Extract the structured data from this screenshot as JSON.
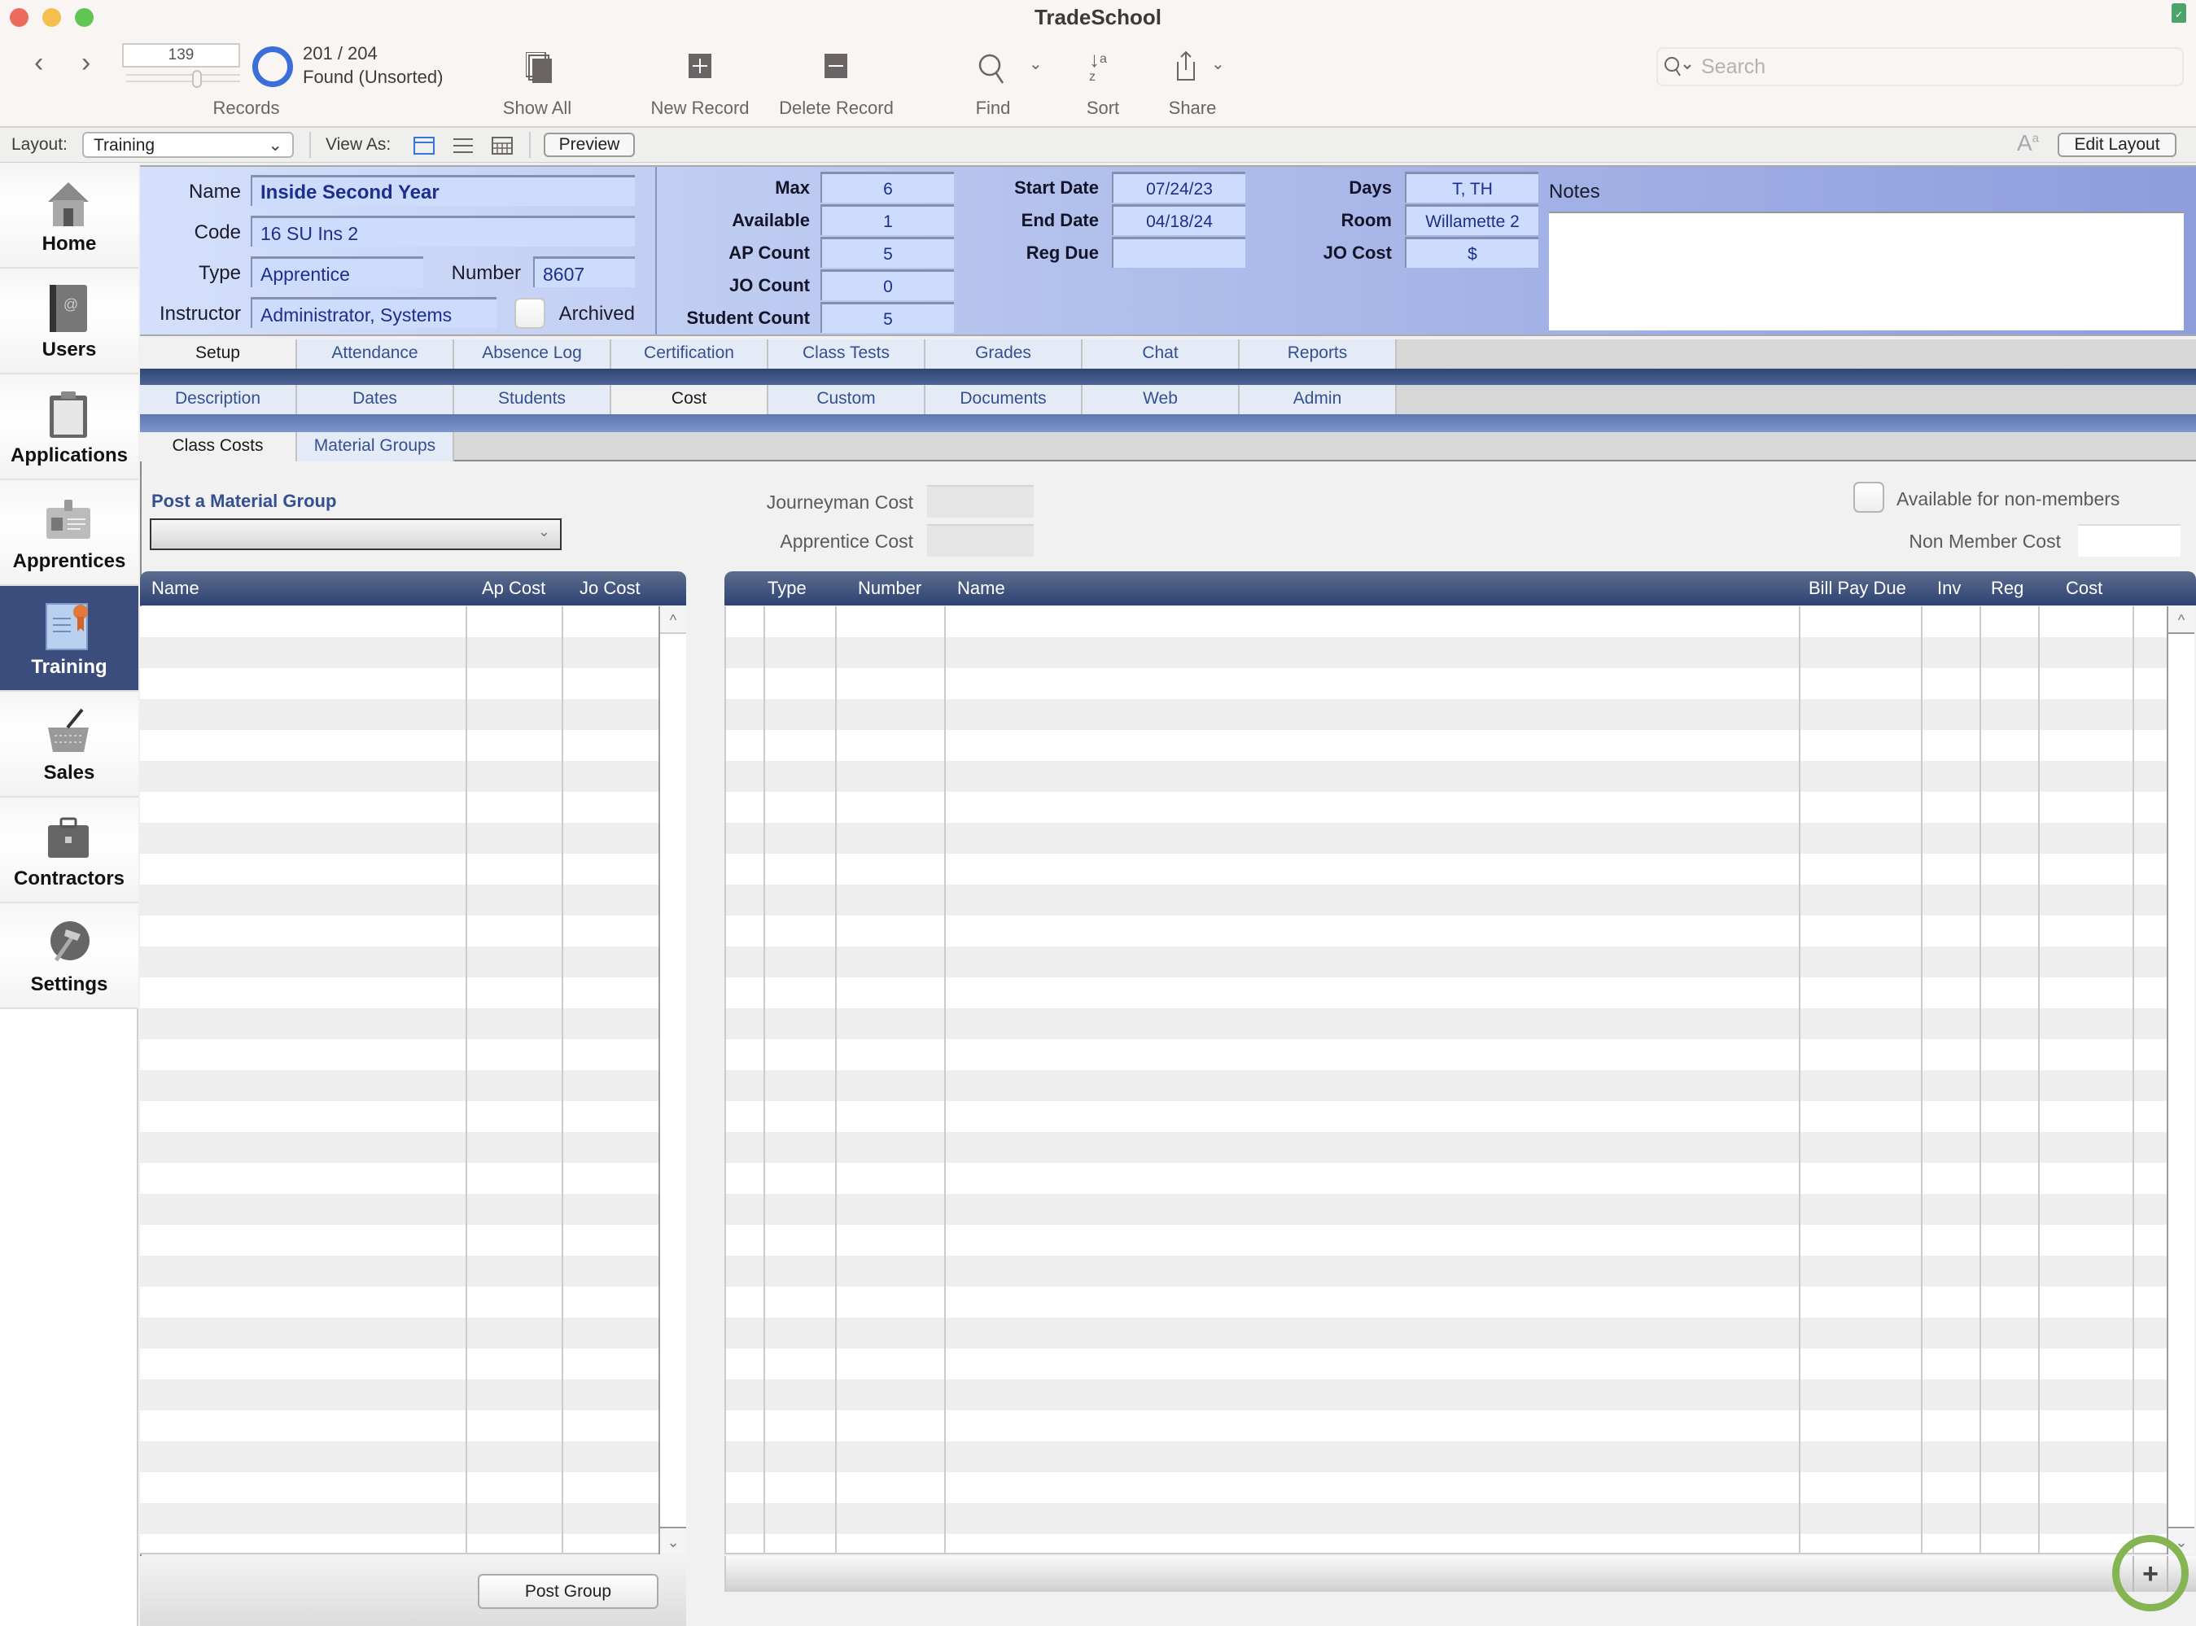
{
  "window": {
    "title": "TradeSchool"
  },
  "toolbar": {
    "record_number": "139",
    "found_count": "201 / 204",
    "found_status": "Found (Unsorted)",
    "records_label": "Records",
    "show_all": "Show All",
    "new_record": "New Record",
    "delete_record": "Delete Record",
    "find": "Find",
    "sort": "Sort",
    "share": "Share",
    "search_placeholder": "Search"
  },
  "layout_bar": {
    "layout_label": "Layout:",
    "layout_value": "Training",
    "view_as_label": "View As:",
    "preview": "Preview",
    "edit_layout": "Edit Layout"
  },
  "sidebar": {
    "items": [
      {
        "label": "Home",
        "icon": "house-icon"
      },
      {
        "label": "Users",
        "icon": "address-book-icon"
      },
      {
        "label": "Applications",
        "icon": "clipboard-icon"
      },
      {
        "label": "Apprentices",
        "icon": "id-badge-icon"
      },
      {
        "label": "Training",
        "icon": "certificate-icon",
        "active": true
      },
      {
        "label": "Sales",
        "icon": "basket-icon"
      },
      {
        "label": "Contractors",
        "icon": "briefcase-icon"
      },
      {
        "label": "Settings",
        "icon": "hammer-globe-icon"
      }
    ]
  },
  "header": {
    "name_label": "Name",
    "name": "Inside Second Year",
    "code_label": "Code",
    "code": "16 SU Ins 2",
    "type_label": "Type",
    "type": "Apprentice",
    "number_label": "Number",
    "number": "8607",
    "instructor_label": "Instructor",
    "instructor": "Administrator, Systems",
    "archived_label": "Archived",
    "max_label": "Max",
    "max": "6",
    "available_label": "Available",
    "available": "1",
    "ap_count_label": "AP Count",
    "ap_count": "5",
    "jo_count_label": "JO Count",
    "jo_count": "0",
    "student_count_label": "Student Count",
    "student_count": "5",
    "start_date_label": "Start Date",
    "start_date": "07/24/23",
    "end_date_label": "End Date",
    "end_date": "04/18/24",
    "reg_due_label": "Reg Due",
    "reg_due": "",
    "days_label": "Days",
    "days": "T, TH",
    "room_label": "Room",
    "room": "Willamette 2",
    "jo_cost_label": "JO Cost",
    "jo_cost": "$",
    "notes_label": "Notes",
    "notes": ""
  },
  "tabs_main": [
    "Setup",
    "Attendance",
    "Absence Log",
    "Certification",
    "Class Tests",
    "Grades",
    "Chat",
    "Reports"
  ],
  "tabs_setup": [
    "Description",
    "Dates",
    "Students",
    "Cost",
    "Custom",
    "Documents",
    "Web",
    "Admin"
  ],
  "tabs_cost": [
    "Class Costs",
    "Material Groups"
  ],
  "cost": {
    "post_group_label": "Post a Material Group",
    "post_group_value": "",
    "journeyman_cost_label": "Journeyman Cost",
    "apprentice_cost_label": "Apprentice Cost",
    "available_nonmembers_label": "Available for non-members",
    "non_member_cost_label": "Non Member Cost",
    "post_group_button": "Post Group",
    "left_table": {
      "columns": [
        "Name",
        "Ap Cost",
        "Jo Cost"
      ],
      "rows": []
    },
    "right_table": {
      "columns": [
        "Type",
        "Number",
        "Name",
        "Bill Pay Due",
        "Inv",
        "Reg",
        "Cost"
      ],
      "rows": []
    },
    "add_button": "+"
  },
  "colors": {
    "accent": "#3a4d7d",
    "header_gradient_end": "#8d9ddc",
    "field_text": "#1d2e8c",
    "highlight_ring": "#85b553"
  }
}
